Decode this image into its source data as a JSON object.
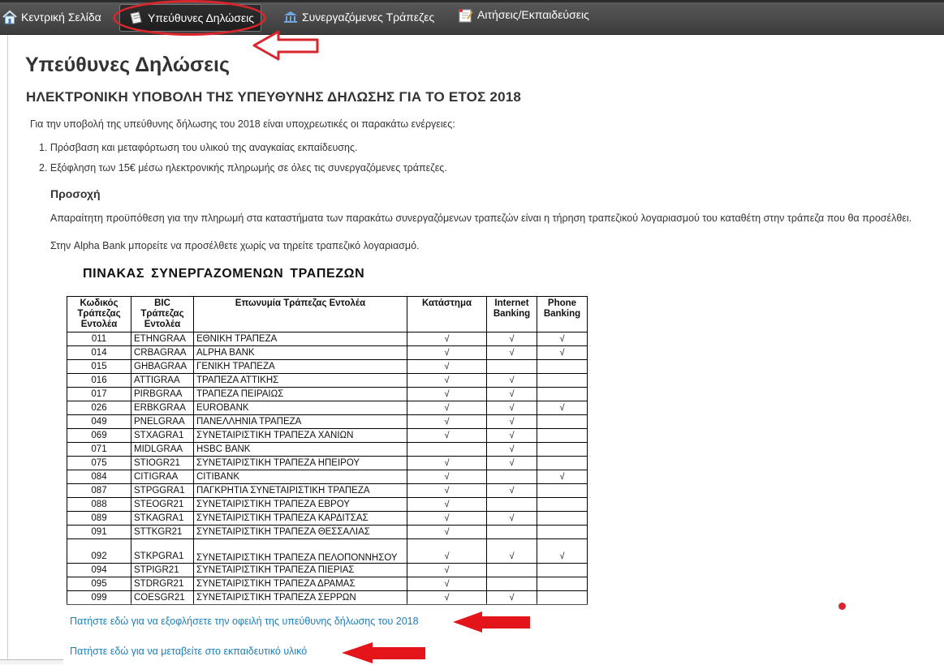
{
  "nav": {
    "home": "Κεντρική Σελίδα",
    "declarations": "Υπεύθυνες Δηλώσεις",
    "banks": "Συνεργαζόμενες Τράπεζες",
    "applications": "Αιτήσεις/Εκπαιδεύσεις"
  },
  "page": {
    "title": "Υπεύθυνες Δηλώσεις",
    "subtitle": "ΗΛΕΚΤΡΟΝΙΚΗ ΥΠΟΒΟΛΗ ΤΗΣ ΥΠΕΥΘΥΝΗΣ ΔΗΛΩΣΗΣ ΓΙΑ ΤΟ ΕΤΟΣ 2018",
    "intro": "Για την υποβολή της υπεύθυνης δήλωσης του 2018 είναι υποχρεωτικές οι παρακάτω ενέργειες:",
    "steps": [
      "1.  Πρόσβαση και μεταφόρτωση του υλικού της αναγκαίας εκπαίδευσης.",
      "2.  Εξόφληση των 15€ μέσω ηλεκτρονικής πληρωμής σε όλες τις συνεργαζόμενες τράπεζες."
    ],
    "caution_title": "Προσοχή",
    "caution_text": "Απαραίτητη προϋπόθεση για την πληρωμή στα καταστήματα των παρακάτω συνεργαζόμενων τραπεζών είναι η τήρηση τραπεζικού λογαριασμού του καταθέτη στην τράπεζα που θα προσέλθει.",
    "alpha_note": "Στην Alpha Bank μπορείτε να προσέλθετε χωρίς να τηρείτε τραπεζικό λογαριασμό.",
    "table_title": "ΠΙΝΑΚΑΣ  ΣΥΝΕΡΓΑΖΟΜΕΝΩΝ  ΤΡΑΠΕΖΩΝ"
  },
  "table": {
    "headers": {
      "code": "Κωδικός Τράπεζας Εντολέα",
      "bic": "BIC Τράπεζας Εντολέα",
      "name": "Επωνυμία Τράπεζας Εντολέα",
      "store": "Κατάστημα",
      "internet": "Internet Banking",
      "phone": "Phone Banking"
    },
    "check": "√",
    "rows": [
      {
        "code": "011",
        "bic": "ETHNGRAA",
        "name": "ΕΘΝΙΚΗ ΤΡΑΠΕΖΑ",
        "store": true,
        "internet": true,
        "phone": true
      },
      {
        "code": "014",
        "bic": "CRBAGRAA",
        "name": "ALPHA BANK",
        "store": true,
        "internet": true,
        "phone": true
      },
      {
        "code": "015",
        "bic": "GHBAGRAA",
        "name": "ΓΕΝΙΚΗ ΤΡΑΠΕΖΑ",
        "store": true,
        "internet": false,
        "phone": false
      },
      {
        "code": "016",
        "bic": "ATTIGRAA",
        "name": "ΤΡΑΠΕΖΑ ΑΤΤΙΚΗΣ",
        "store": true,
        "internet": true,
        "phone": false
      },
      {
        "code": "017",
        "bic": "PIRBGRAA",
        "name": "ΤΡΑΠΕΖΑ ΠΕΙΡΑΙΩΣ",
        "store": true,
        "internet": true,
        "phone": false
      },
      {
        "code": "026",
        "bic": "ERBKGRAA",
        "name": "EUROBANK",
        "store": true,
        "internet": true,
        "phone": true
      },
      {
        "code": "049",
        "bic": "PNELGRAA",
        "name": "ΠΑΝΕΛΛΗΝΙΑ ΤΡΑΠΕΖΑ",
        "store": true,
        "internet": true,
        "phone": false
      },
      {
        "code": "069",
        "bic": "STXAGRA1",
        "name": "ΣΥΝΕΤΑΙΡΙΣΤΙΚΗ  ΤΡΑΠΕΖΑ ΧΑΝΙΩΝ",
        "store": true,
        "internet": true,
        "phone": false
      },
      {
        "code": "071",
        "bic": "MIDLGRAA",
        "name": "HSBC BANK",
        "store": false,
        "internet": true,
        "phone": false
      },
      {
        "code": "075",
        "bic": "STIOGR21",
        "name": "ΣΥΝΕΤΑΙΡΙΣΤΙΚΗ  ΤΡΑΠΕΖΑ ΗΠΕΙΡΟΥ",
        "store": true,
        "internet": true,
        "phone": false
      },
      {
        "code": "084",
        "bic": "CITIGRAA",
        "name": "CITIBANK",
        "store": true,
        "internet": false,
        "phone": true
      },
      {
        "code": "087",
        "bic": "STPGGRA1",
        "name": "ΠΑΓΚΡΗΤΙΑ ΣΥΝΕΤΑΙΡΙΣΤΙΚΗ  ΤΡΑΠΕΖΑ",
        "store": true,
        "internet": true,
        "phone": false
      },
      {
        "code": "088",
        "bic": "STEOGR21",
        "name": "ΣΥΝΕΤΑΙΡΙΣΤΙΚΗ  ΤΡΑΠΕΖΑ ΕΒΡΟΥ",
        "store": true,
        "internet": false,
        "phone": false
      },
      {
        "code": "089",
        "bic": "STKAGRA1",
        "name": "ΣΥΝΕΤΑΙΡΙΣΤΙΚΗ  ΤΡΑΠΕΖΑ ΚΑΡΔΙΤΣΑΣ",
        "store": true,
        "internet": true,
        "phone": false
      },
      {
        "code": "091",
        "bic": "STTKGR21",
        "name": "ΣΥΝΕΤΑΙΡΙΣΤΙΚΗ  ΤΡΑΠΕΖΑ ΘΕΣΣΑΛΙΑΣ",
        "store": true,
        "internet": false,
        "phone": false
      },
      {
        "code": "092",
        "bic": "STKPGRA1",
        "name": "ΣΥΝΕΤΑΙΡΙΣΤΙΚΗ  ΤΡΑΠΕΖΑ ΠΕΛΟΠΟΝΝΗΣΟΥ",
        "store": true,
        "internet": true,
        "phone": true,
        "tall": true
      },
      {
        "code": "094",
        "bic": "STPIGR21",
        "name": "ΣΥΝΕΤΑΙΡΙΣΤΙΚΗ  ΤΡΑΠΕΖΑ ΠΙΕΡΙΑΣ",
        "store": true,
        "internet": false,
        "phone": false
      },
      {
        "code": "095",
        "bic": "STDRGR21",
        "name": "ΣΥΝΕΤΑΙΡΙΣΤΙΚΗ  ΤΡΑΠΕΖΑ ΔΡΑΜΑΣ",
        "store": true,
        "internet": false,
        "phone": false
      },
      {
        "code": "099",
        "bic": "COESGR21",
        "name": "ΣΥΝΕΤΑΙΡΙΣΤΙΚΗ  ΤΡΑΠΕΖΑ ΣΕΡΡΩΝ",
        "store": true,
        "internet": true,
        "phone": false
      }
    ]
  },
  "links": {
    "pay": "Πατήστε εδώ για να εξοφλήσετε την οφειλή της υπεύθυνης δήλωσης του 2018",
    "material": "Πατήστε εδώ για να μεταβείτε στο εκπαιδευτικό υλικό"
  },
  "colors": {
    "annotation": "#d9262c",
    "link": "#1c7eb8",
    "navbar": "#4a4a4a"
  },
  "icons": [
    "home-icon",
    "declaration-icon",
    "bank-icon",
    "applications-icon"
  ]
}
